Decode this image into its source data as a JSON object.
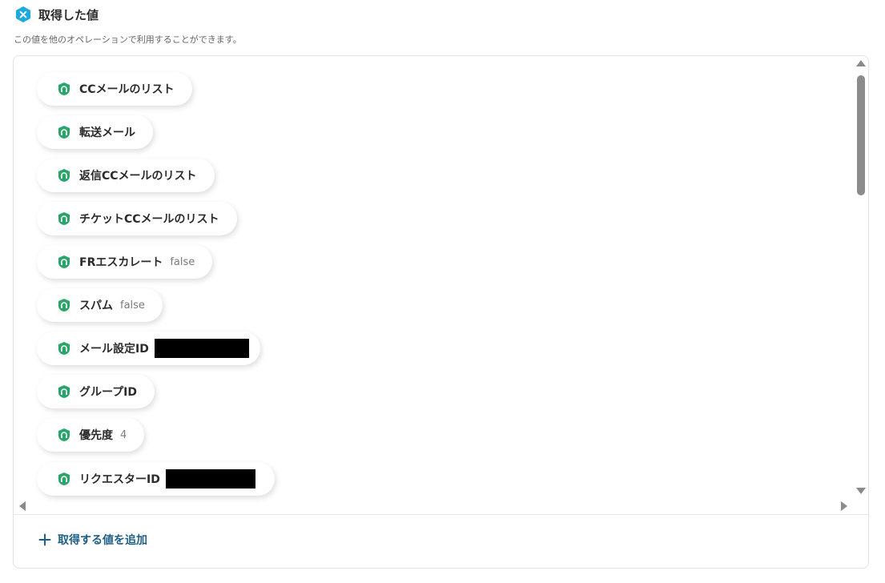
{
  "header": {
    "icon": "hexagon-x-icon",
    "title": "取得した値",
    "subtitle": "この値を他のオペレーションで利用することができます。"
  },
  "colors": {
    "accent_hex": "#1ba9e1",
    "chip_icon_green": "#2aa56a",
    "link_blue": "#1f5f86"
  },
  "items": [
    {
      "label": "CCメールのリスト",
      "value": "",
      "redacted": false,
      "icon": "zendesk-icon"
    },
    {
      "label": "転送メール",
      "value": "",
      "redacted": false,
      "icon": "zendesk-icon"
    },
    {
      "label": "返信CCメールのリスト",
      "value": "",
      "redacted": false,
      "icon": "zendesk-icon"
    },
    {
      "label": "チケットCCメールのリスト",
      "value": "",
      "redacted": false,
      "icon": "zendesk-icon"
    },
    {
      "label": "FRエスカレート",
      "value": "false",
      "redacted": false,
      "icon": "zendesk-icon"
    },
    {
      "label": "スパム",
      "value": "false",
      "redacted": false,
      "icon": "zendesk-icon"
    },
    {
      "label": "メール設定ID",
      "value": "",
      "redacted": true,
      "icon": "zendesk-icon"
    },
    {
      "label": "グループID",
      "value": "",
      "redacted": false,
      "icon": "zendesk-icon"
    },
    {
      "label": "優先度",
      "value": "4",
      "redacted": false,
      "icon": "zendesk-icon"
    },
    {
      "label": "リクエスターID",
      "value": "",
      "redacted": true,
      "icon": "zendesk-icon"
    }
  ],
  "footer": {
    "add_label": "取得する値を追加",
    "add_icon": "plus-icon"
  }
}
